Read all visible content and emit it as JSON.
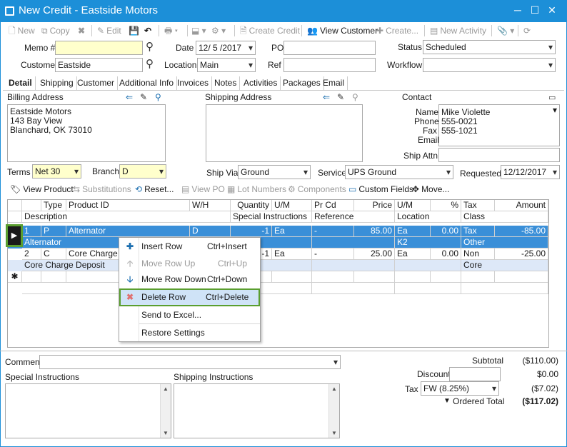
{
  "window": {
    "title": "New Credit - Eastside Motors",
    "minimize": "─",
    "maximize": "☐",
    "close": "✕"
  },
  "toolbar": {
    "new": "New",
    "copy": "Copy",
    "edit": "Edit",
    "create_credit": "Create Credit",
    "view_customer": "View Customer",
    "create": "Create...",
    "new_activity": "New Activity"
  },
  "header": {
    "memo_label": "Memo #",
    "memo_value": "",
    "date_label": "Date",
    "date_value": "12/ 5 /2017",
    "po_label": "PO",
    "po_value": "",
    "status_label": "Status",
    "status_value": "Scheduled",
    "customer_label": "Customer",
    "customer_value": "Eastside",
    "location_label": "Location",
    "location_value": "Main",
    "ref_label": "Ref",
    "ref_value": "",
    "workflow_label": "Workflow",
    "workflow_value": ""
  },
  "tabs": [
    "Detail",
    "Shipping",
    "Customer",
    "Additional Info",
    "Invoices",
    "Notes",
    "Activities",
    "Packages",
    "Email"
  ],
  "billing": {
    "label": "Billing Address",
    "line1": "Eastside Motors",
    "line2": "143 Bay View",
    "line3": "Blanchard, OK 73010"
  },
  "shipping": {
    "label": "Shipping Address"
  },
  "contact": {
    "label": "Contact",
    "name_label": "Name",
    "name_value": "Mike Violette",
    "phone_label": "Phone",
    "phone_value": "555-0021",
    "fax_label": "Fax",
    "fax_value": "555-1021",
    "email_label": "Email",
    "email_value": "",
    "ship_attn_label": "Ship Attn",
    "ship_attn_value": ""
  },
  "terms": {
    "terms_label": "Terms",
    "terms_value": "Net 30",
    "branch_label": "Branch",
    "branch_value": "D",
    "shipvia_label": "Ship Via",
    "shipvia_value": "Ground",
    "service_label": "Service",
    "service_value": "UPS Ground",
    "requested_label": "Requested",
    "requested_value": "12/12/2017"
  },
  "grid_toolbar": {
    "view_product": "View Product",
    "substitutions": "Substitutions",
    "reset": "Reset...",
    "view_po": "View PO",
    "lot_numbers": "Lot Numbers",
    "components": "Components",
    "custom_fields": "Custom Fields",
    "move": "Move..."
  },
  "grid": {
    "headers1": [
      "Type",
      "Product ID",
      "W/H",
      "Quantity",
      "U/M",
      "Pr Cd",
      "Price",
      "U/M",
      "%",
      "Tax",
      "Amount"
    ],
    "headers2": [
      "Description",
      "Special Instructions",
      "Reference",
      "Location",
      "Class"
    ],
    "rows": [
      {
        "num": "1",
        "type": "P",
        "product": "Alternator",
        "wh": "D",
        "qty": "-1",
        "um": "Ea",
        "prcd": "-",
        "price": "85.00",
        "um2": "Ea",
        "pct": "0.00",
        "tax": "Tax",
        "amount": "-85.00",
        "desc": "Alternator",
        "location": "K2",
        "class": "Other"
      },
      {
        "num": "2",
        "type": "C",
        "product": "Core Charge",
        "wh": "",
        "qty": "-1",
        "um": "Ea",
        "prcd": "-",
        "price": "25.00",
        "um2": "Ea",
        "pct": "0.00",
        "tax": "Non",
        "amount": "-25.00",
        "desc": "Core Charge Deposit",
        "location": "",
        "class": "Core"
      }
    ],
    "new_row_marker": "✱"
  },
  "context_menu": [
    {
      "label": "Insert Row",
      "shortcut": "Ctrl+Insert",
      "icon": "plus-icon",
      "enabled": true
    },
    {
      "label": "Move Row Up",
      "shortcut": "Ctrl+Up",
      "icon": "arrow-up-icon",
      "enabled": false
    },
    {
      "label": "Move Row Down",
      "shortcut": "Ctrl+Down",
      "icon": "arrow-down-icon",
      "enabled": true
    },
    {
      "label": "Delete Row",
      "shortcut": "Ctrl+Delete",
      "icon": "delete-x-icon",
      "enabled": true
    },
    {
      "label": "Send to Excel...",
      "shortcut": "",
      "icon": "",
      "enabled": true
    },
    {
      "label": "Restore Settings",
      "shortcut": "",
      "icon": "",
      "enabled": true
    }
  ],
  "footer": {
    "comment_label": "Comment",
    "comment_value": "",
    "special_label": "Special Instructions",
    "shipping_label": "Shipping Instructions",
    "subtotal_label": "Subtotal",
    "subtotal_value": "($110.00)",
    "discount_label": "Discount",
    "discount_value": "$0.00",
    "tax_label": "Tax",
    "tax_select": "FW (8.25%)",
    "tax_value": "($7.02)",
    "ordered_label": "Ordered Total",
    "ordered_value": "($117.02)"
  },
  "colors": {
    "titlebar": "#1c8fd8",
    "selected_row": "#3a8fd8",
    "highlight_border": "#5a9e2f"
  }
}
